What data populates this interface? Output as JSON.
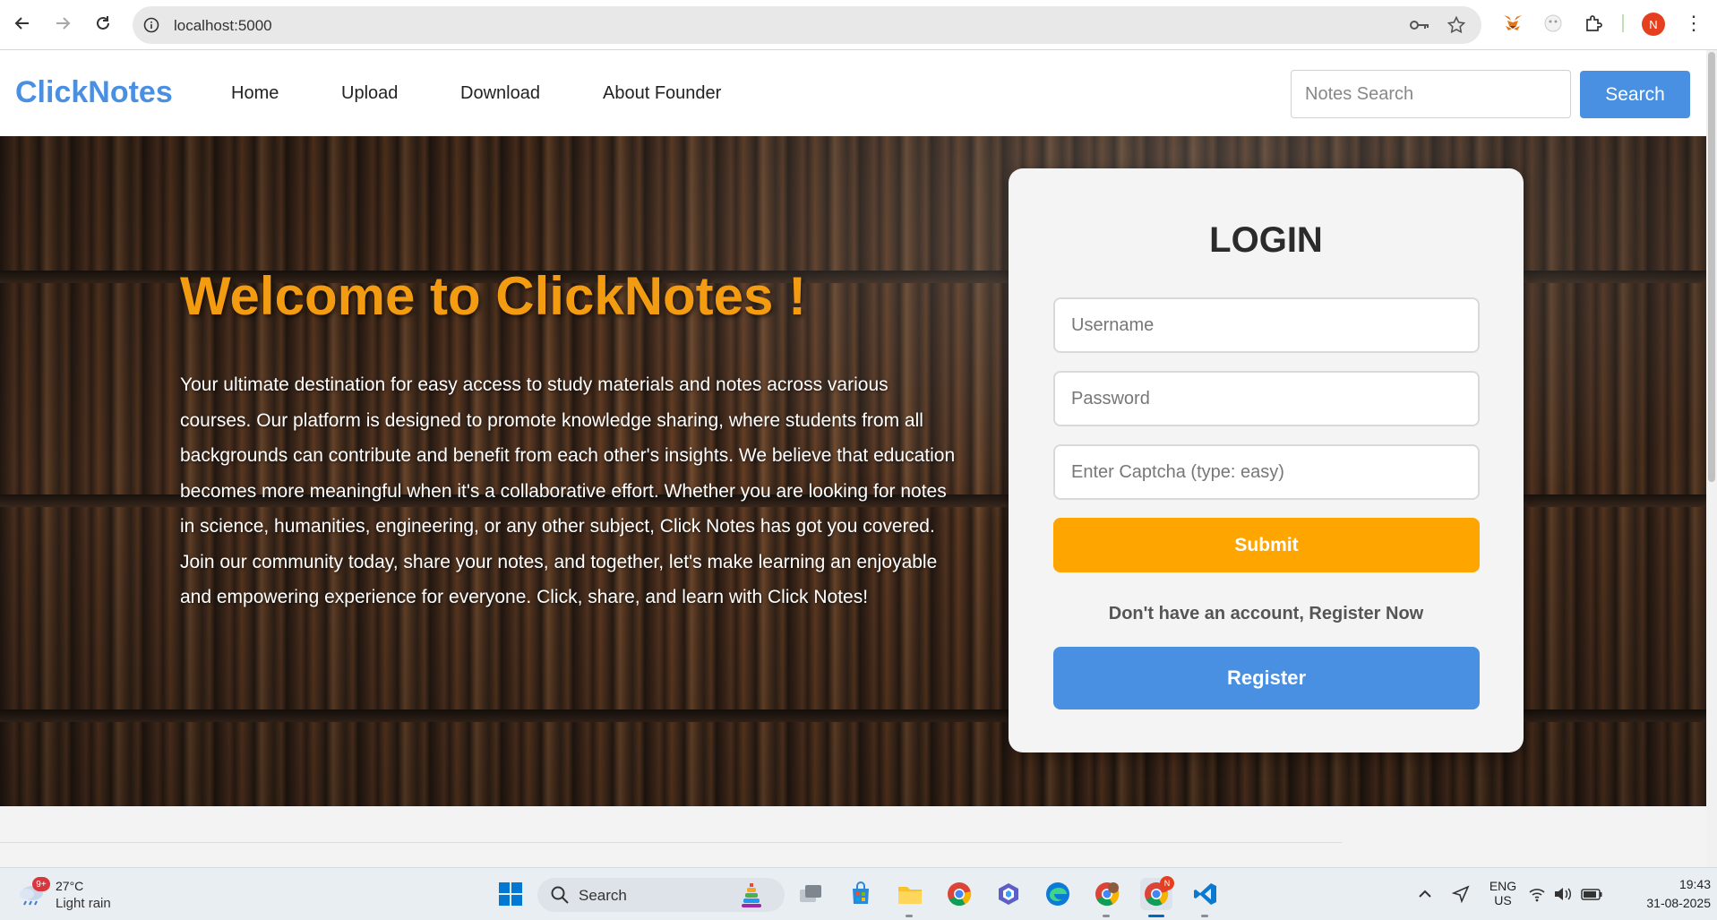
{
  "browser": {
    "url": "localhost:5000",
    "profile_initial": "N"
  },
  "site": {
    "logo": "ClickNotes",
    "nav": [
      "Home",
      "Upload",
      "Download",
      "About Founder"
    ],
    "search_placeholder": "Notes Search",
    "search_button": "Search"
  },
  "hero": {
    "title": "Welcome to ClickNotes !",
    "text": "Your ultimate destination for easy access to study materials and notes across various courses. Our platform is designed to promote knowledge sharing, where students from all backgrounds can contribute and benefit from each other's insights. We believe that education becomes more meaningful when it's a collaborative effort. Whether you are looking for notes in science, humanities, engineering, or any other subject, Click Notes has got you covered. Join our community today, share your notes, and together, let's make learning an enjoyable and empowering experience for everyone. Click, share, and learn with Click Notes!"
  },
  "login": {
    "title": "LOGIN",
    "username_placeholder": "Username",
    "password_placeholder": "Password",
    "captcha_placeholder": "Enter Captcha (type: easy)",
    "submit_label": "Submit",
    "register_prompt": "Don't have an account, Register Now",
    "register_label": "Register"
  },
  "taskbar": {
    "weather_badge": "9+",
    "temperature": "27°C",
    "weather_desc": "Light rain",
    "search_label": "Search",
    "lang_line1": "ENG",
    "lang_line2": "US",
    "time": "19:43",
    "date": "31-08-2025",
    "chrome_badge": "N"
  },
  "colors": {
    "brand_blue": "#4a90e2",
    "accent_orange": "#ffa500",
    "title_orange": "#f39c12"
  }
}
